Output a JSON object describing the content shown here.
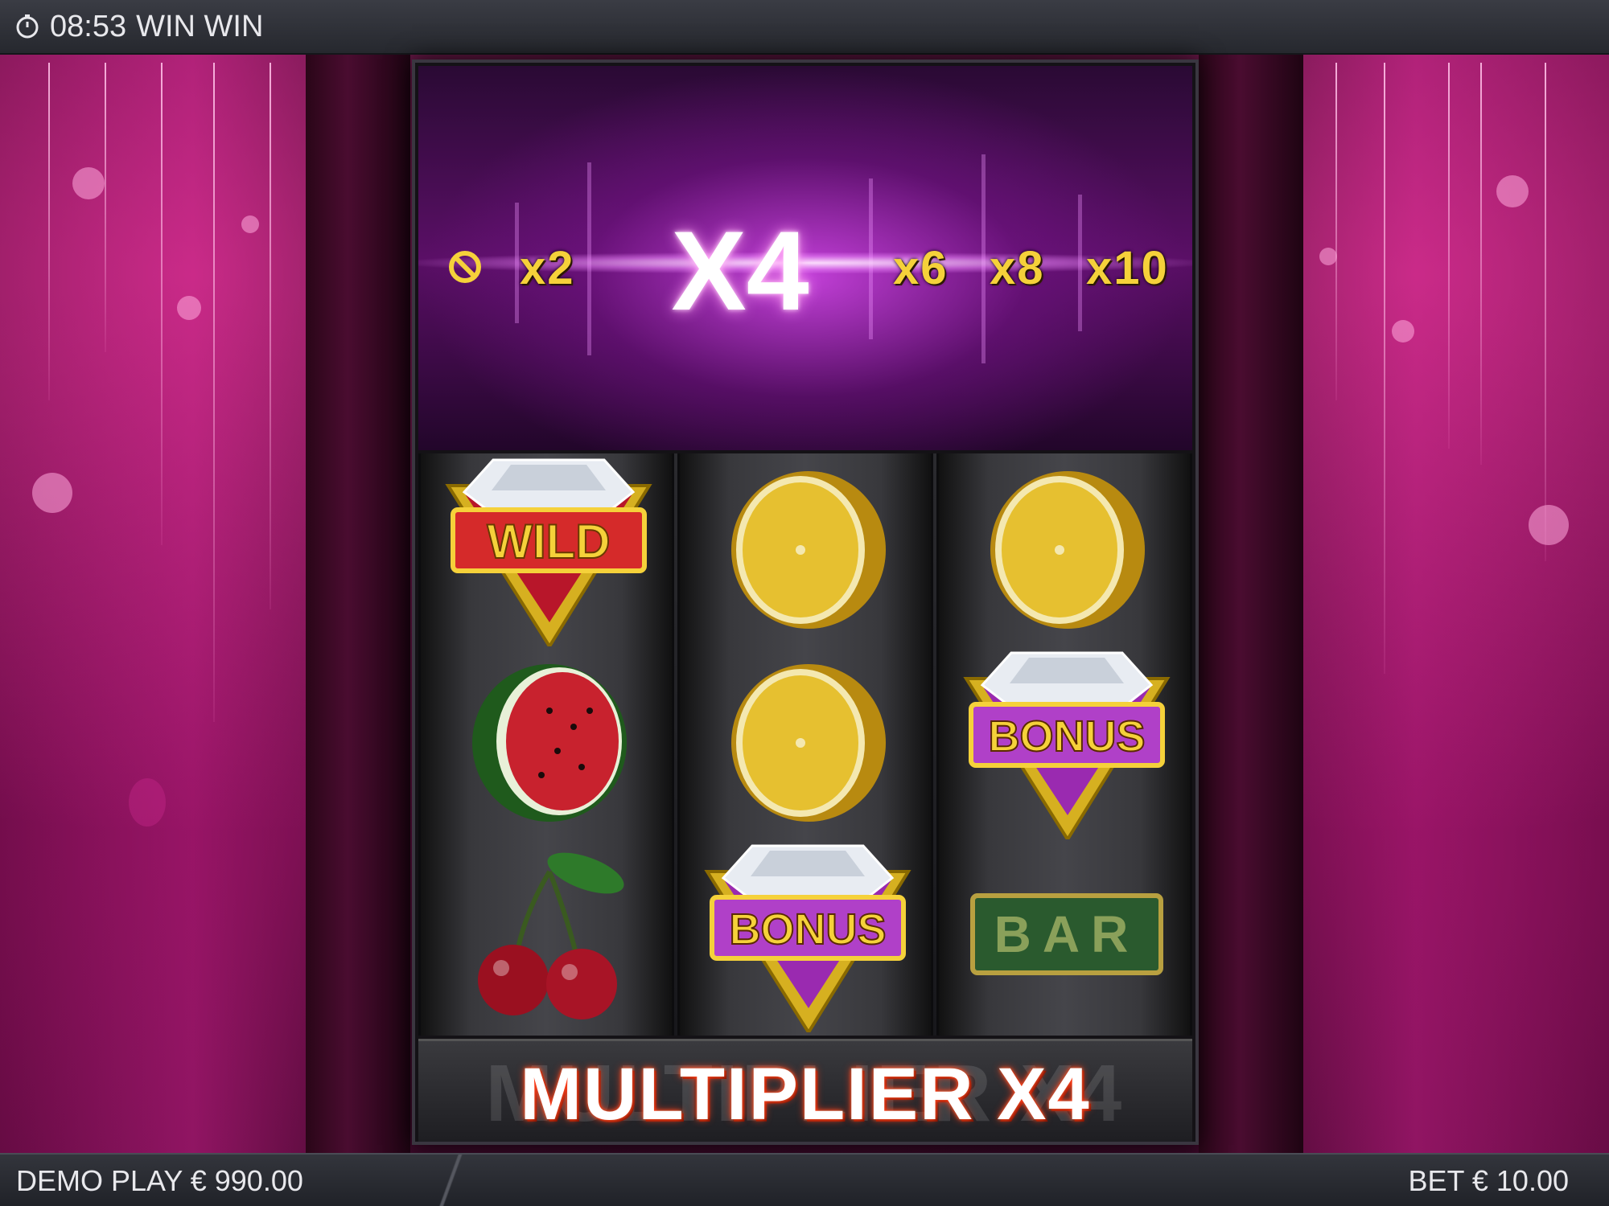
{
  "status_bar": {
    "time": "08:53",
    "title": "WIN WIN",
    "icon": "clock-icon"
  },
  "multiplier_track": {
    "items": [
      "x2",
      "X4",
      "x6",
      "x8",
      "x10"
    ],
    "active": "X4",
    "first_icon": "no-multiplier-icon",
    "colors": {
      "inactive": "#f5d13a",
      "active": "#ffffff"
    }
  },
  "reels": [
    {
      "symbols": [
        {
          "type": "wild",
          "label": "WILD"
        },
        {
          "type": "watermelon"
        },
        {
          "type": "cherries"
        }
      ]
    },
    {
      "symbols": [
        {
          "type": "lemon"
        },
        {
          "type": "lemon"
        },
        {
          "type": "bonus",
          "label": "BONUS"
        }
      ]
    },
    {
      "symbols": [
        {
          "type": "lemon"
        },
        {
          "type": "bonus",
          "label": "BONUS"
        },
        {
          "type": "bar",
          "label": "BAR"
        }
      ]
    }
  ],
  "banner": {
    "text": "MULTIPLIER X4",
    "ghost": "MULTIPLIER X4"
  },
  "bottom_bar": {
    "balance_label": "DEMO PLAY € 990.00",
    "bet_label": "BET € 10.00"
  }
}
